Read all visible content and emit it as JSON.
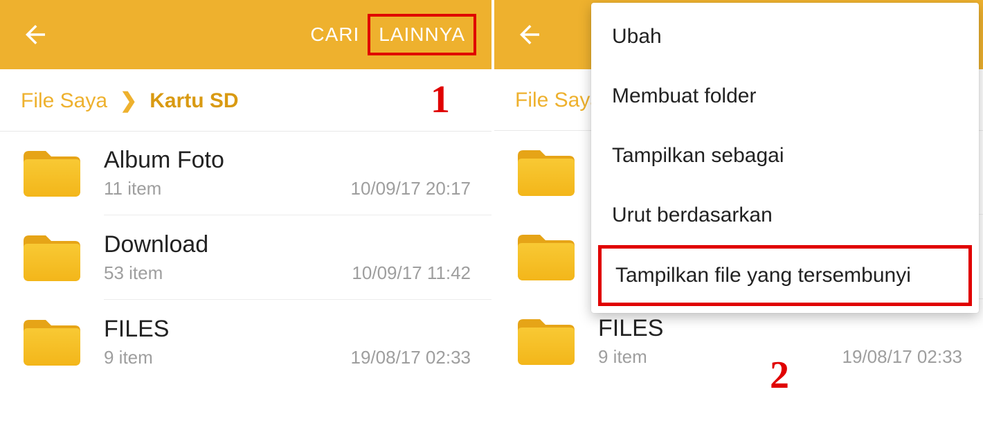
{
  "appbar": {
    "search": "CARI",
    "more": "LAINNYA"
  },
  "breadcrumb": {
    "root": "File Saya",
    "current": "Kartu SD"
  },
  "folders": [
    {
      "name": "Album Foto",
      "count": "11 item",
      "date": "10/09/17 20:17"
    },
    {
      "name": "Download",
      "count": "53 item",
      "date": "10/09/17 11:42"
    },
    {
      "name": "FILES",
      "count": "9 item",
      "date": "19/08/17 02:33"
    }
  ],
  "menu": {
    "edit": "Ubah",
    "new_folder": "Membuat folder",
    "view_as": "Tampilkan sebagai",
    "sort_by": "Urut berdasarkan",
    "show_hidden": "Tampilkan file yang tersembunyi"
  },
  "steps": {
    "one": "1",
    "two": "2"
  }
}
